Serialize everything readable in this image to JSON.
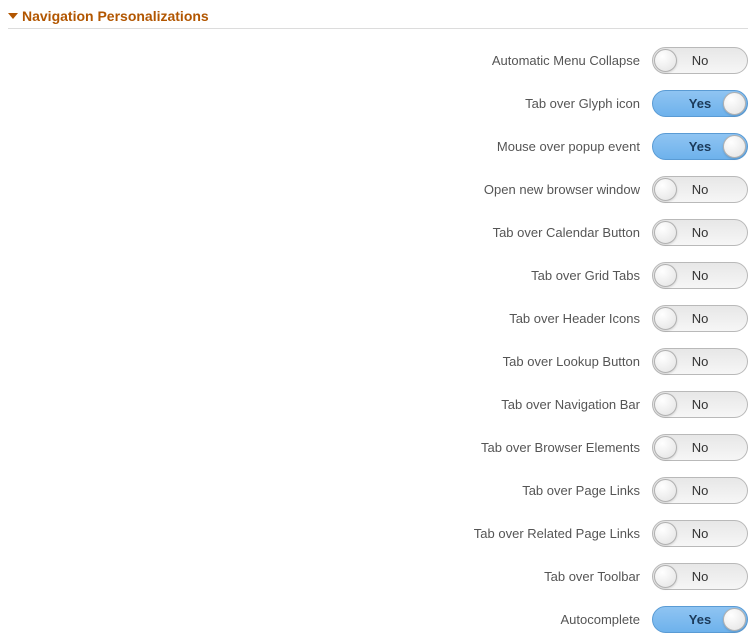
{
  "section": {
    "title": "Navigation Personalizations"
  },
  "toggle_labels": {
    "on": "Yes",
    "off": "No"
  },
  "settings": [
    {
      "label": "Automatic Menu Collapse",
      "value": "No"
    },
    {
      "label": "Tab over Glyph icon",
      "value": "Yes"
    },
    {
      "label": "Mouse over popup event",
      "value": "Yes"
    },
    {
      "label": "Open new browser window",
      "value": "No"
    },
    {
      "label": "Tab over Calendar Button",
      "value": "No"
    },
    {
      "label": "Tab over Grid Tabs",
      "value": "No"
    },
    {
      "label": "Tab over Header Icons",
      "value": "No"
    },
    {
      "label": "Tab over Lookup Button",
      "value": "No"
    },
    {
      "label": "Tab over Navigation Bar",
      "value": "No"
    },
    {
      "label": "Tab over Browser Elements",
      "value": "No"
    },
    {
      "label": "Tab over Page Links",
      "value": "No"
    },
    {
      "label": "Tab over Related Page Links",
      "value": "No"
    },
    {
      "label": "Tab over Toolbar",
      "value": "No"
    },
    {
      "label": "Autocomplete",
      "value": "Yes"
    }
  ]
}
